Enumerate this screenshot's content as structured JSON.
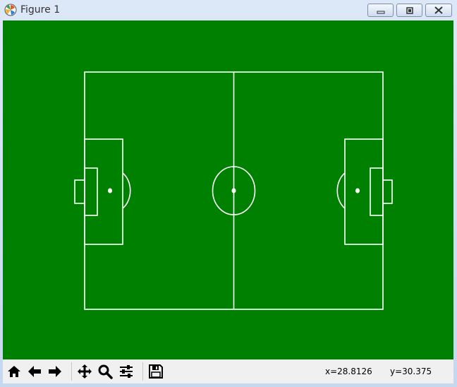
{
  "window": {
    "title": "Figure 1",
    "icons": {
      "app": "matplotlib-logo-icon",
      "minimize": "minimize-icon",
      "maximize": "maximize-icon",
      "close": "close-icon"
    }
  },
  "figure": {
    "background_color": "#008000",
    "line_color": "#ffffff"
  },
  "toolbar": {
    "buttons": [
      {
        "name": "home",
        "icon": "home-icon"
      },
      {
        "name": "back",
        "icon": "arrow-left-icon"
      },
      {
        "name": "forward",
        "icon": "arrow-right-icon"
      },
      {
        "name": "pan",
        "icon": "move-icon"
      },
      {
        "name": "zoom",
        "icon": "magnifier-icon"
      },
      {
        "name": "configure-subplots",
        "icon": "sliders-icon"
      },
      {
        "name": "save",
        "icon": "floppy-disk-icon"
      }
    ],
    "x_readout": "x=28.8126",
    "y_readout": "y=30.375"
  }
}
